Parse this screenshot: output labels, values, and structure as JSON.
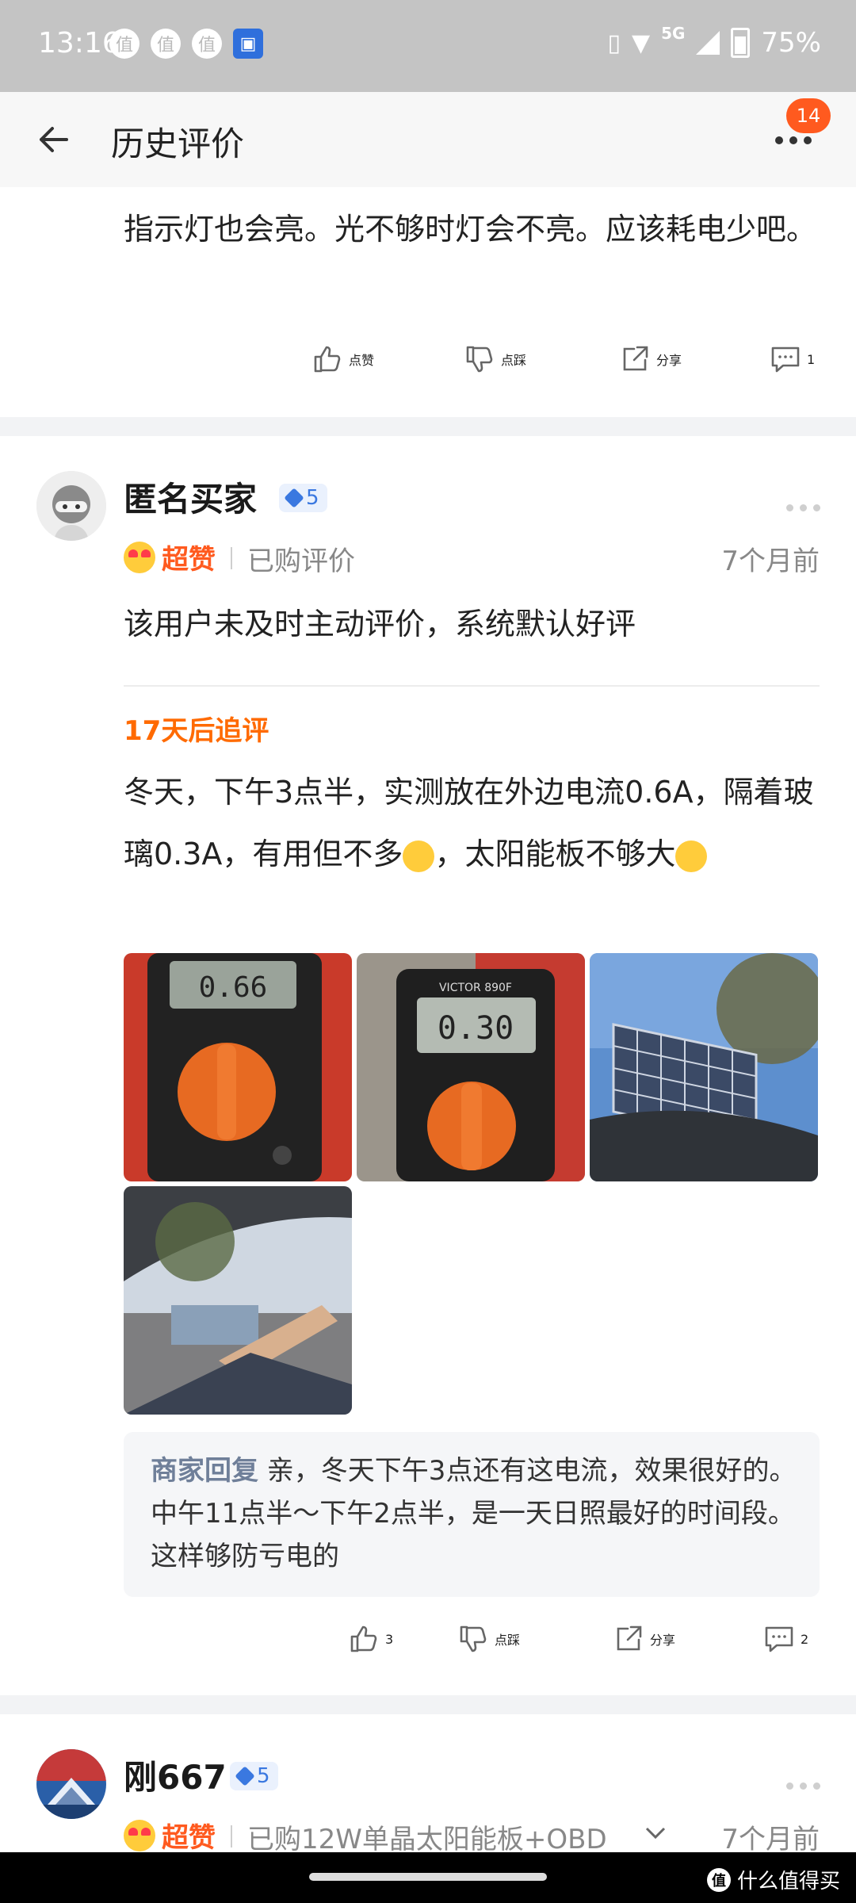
{
  "status_bar": {
    "time": "13:16",
    "network": "5G",
    "battery": "75%",
    "notification_icons": [
      "值",
      "值",
      "值"
    ]
  },
  "header": {
    "title": "历史评价",
    "badge_count": "14"
  },
  "previous_review": {
    "text": "指示灯也会亮。光不够时灯会不亮。应该耗电少吧。",
    "actions": {
      "like": "点赞",
      "dislike": "点踩",
      "share": "分享",
      "comments": "1"
    }
  },
  "review1": {
    "username": "匿名买家",
    "level": "5",
    "rating": "超赞",
    "purchased": "已购评价",
    "time_ago": "7个月前",
    "text": "该用户未及时主动评价，系统默认好评",
    "followup_title": "17天后追评",
    "followup_text_1": "冬天，下午3点半，实测放在外边电流0.6A，隔着玻璃0.3A，有用但不多",
    "followup_text_2": "，太阳能板不够大",
    "meter_reading_1": "0.66",
    "meter_reading_2": "0.30",
    "meter_brand": "VICTOR 890F",
    "reply_label": "商家回复",
    "reply_text": " 亲，冬天下午3点还有这电流，效果很好的。中午11点半～下午2点半，是一天日照最好的时间段。这样够防亏电的",
    "actions": {
      "like": "3",
      "dislike": "点踩",
      "share": "分享",
      "comments": "2"
    }
  },
  "review2": {
    "username": "刚667",
    "level": "5",
    "rating": "超赞",
    "purchased": "已购12W单晶太阳能板+OBD",
    "time_ago": "7个月前"
  },
  "watermark": "什么值得买",
  "colors": {
    "accent": "#ff6a00",
    "badge": "#ff5a1f",
    "level": "#3a78e0"
  }
}
